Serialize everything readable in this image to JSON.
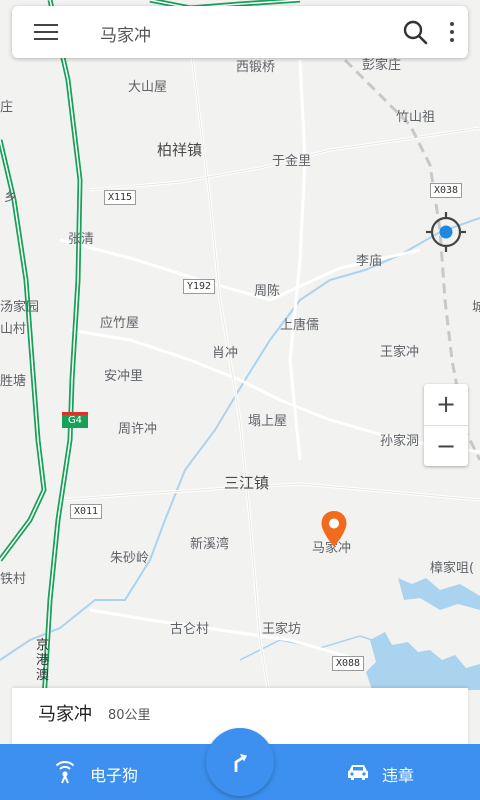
{
  "search": {
    "query": "马家冲"
  },
  "colors": {
    "accent": "#3d90f0",
    "pin": "#f26b1d",
    "expressway": "#17a058",
    "water": "#aad3f0",
    "locate_dot": "#1e88e5"
  },
  "map": {
    "places": [
      "西锻桥",
      "彭家庄",
      "大山屋",
      "竹山祖",
      "柏祥镇",
      "于金里",
      "张清",
      "李庙",
      "周陈",
      "应竹屋",
      "上唐儒",
      "肖冲",
      "王家冲",
      "安冲里",
      "周许冲",
      "塌上屋",
      "孙家洞",
      "三江镇",
      "新溪湾",
      "马家冲",
      "朱砂岭",
      "樟家咀(",
      "古仑村",
      "王家坊",
      "汤家园",
      "山村",
      "胜塘",
      "铁村",
      "乡",
      "庄",
      "城"
    ],
    "road_tags": [
      "X115",
      "X038",
      "Y192",
      "X011",
      "X088"
    ],
    "expressway_shield": "G4",
    "expressway_name": "京港澳"
  },
  "icons": {
    "menu": "menu-icon",
    "search": "search-icon",
    "more": "more-vert-icon",
    "locate": "my-location-icon",
    "zoom_in": "plus-icon",
    "zoom_out": "minus-icon",
    "pin": "map-pin-icon",
    "dog": "radar-icon",
    "car": "car-icon",
    "route": "route-arrow-icon"
  },
  "zoom": {
    "in": "+",
    "out": "−"
  },
  "card": {
    "name": "马家冲",
    "distance": "80公里"
  },
  "bottom": {
    "left_tab": "电子狗",
    "right_tab": "违章"
  }
}
